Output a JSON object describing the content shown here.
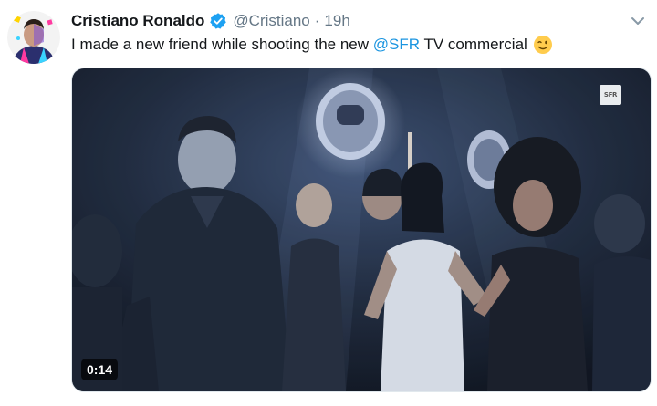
{
  "tweet": {
    "author": {
      "display_name": "Cristiano Ronaldo",
      "handle": "@Cristiano",
      "verified": true
    },
    "separator": "·",
    "timestamp": "19h",
    "text_before": "I made a new friend while shooting the new ",
    "mention": "@SFR",
    "text_after": " TV commercial",
    "emoji": "winking-face"
  },
  "media": {
    "logo_text": "SFR",
    "duration": "0:14"
  },
  "colors": {
    "link": "#1b95e0",
    "verified_badge": "#1da1f2",
    "secondary_text": "#657786"
  }
}
